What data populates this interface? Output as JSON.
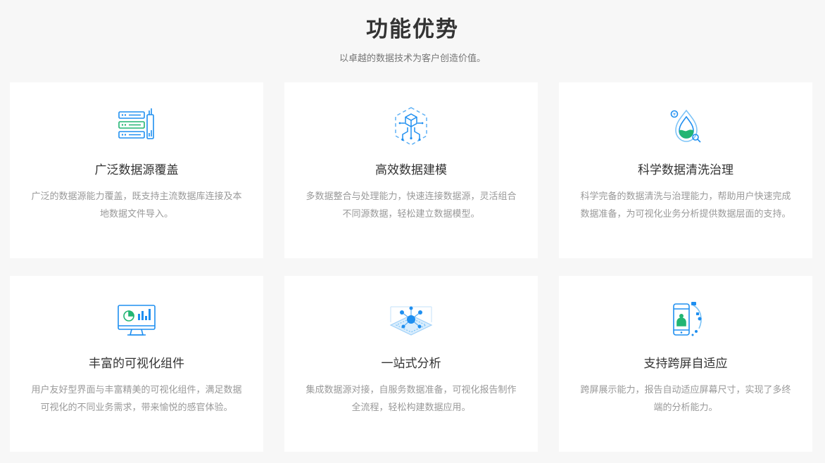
{
  "header": {
    "title": "功能优势",
    "subtitle": "以卓越的数据技术为客户创造价值。"
  },
  "colors": {
    "page_bg": "#f7f7f7",
    "card_bg": "#ffffff",
    "icon_blue": "#1f8ff0",
    "icon_green": "#22b573",
    "title_text": "#333333",
    "desc_text": "#999999"
  },
  "features": [
    {
      "icon": "database-server-icon",
      "title": "广泛数据源覆盖",
      "description": "广泛的数据源能力覆盖，既支持主流数据库连接及本地数据文件导入。"
    },
    {
      "icon": "data-modeling-cube-icon",
      "title": "高效数据建模",
      "description": "多数据整合与处理能力，快速连接数据源，灵活组合不同源数据，轻松建立数据模型。"
    },
    {
      "icon": "data-cleansing-drop-icon",
      "title": "科学数据清洗治理",
      "description": "科学完备的数据清洗与治理能力，帮助用户快速完成数据准备，为可视化业务分析提供数据层面的支持。"
    },
    {
      "icon": "visualization-monitor-icon",
      "title": "丰富的可视化组件",
      "description": "用户友好型界面与丰富精美的可视化组件，满足数据可视化的不同业务需求，带来愉悦的感官体验。"
    },
    {
      "icon": "one-stop-analysis-icon",
      "title": "一站式分析",
      "description": "集成数据源对接，自服务数据准备，可视化报告制作全流程，轻松构建数据应用。"
    },
    {
      "icon": "cross-screen-phone-icon",
      "title": "支持跨屏自适应",
      "description": "跨屏展示能力，报告自动适应屏幕尺寸，实现了多终端的分析能力。"
    }
  ]
}
